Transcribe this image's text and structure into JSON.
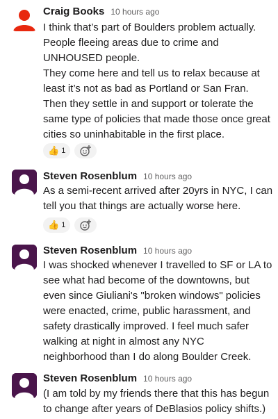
{
  "messages": [
    {
      "author": "Craig Books",
      "time": "10 hours ago",
      "avatar": "red-person-icon",
      "text": "I think that’s part of Boulders problem actually.\nPeople fleeing areas due to crime and\nUNHOUSED people.\nThey come here and tell us to relax because at\nleast it’s not as bad as Portland or San Fran.\nThen they settle in and support or tolerate the\nsame type of policies that made those once great\ncities so uninhabitable in the first place.",
      "reaction": {
        "emoji": "👍",
        "count": "1"
      }
    },
    {
      "author": "Steven Rosenblum",
      "time": "10 hours ago",
      "avatar": "purple-person-icon",
      "text": "As a semi-recent arrived after 20yrs in NYC, I can\ntell you that things are actually worse here.",
      "reaction": {
        "emoji": "👍",
        "count": "1"
      }
    },
    {
      "author": "Steven Rosenblum",
      "time": "10 hours ago",
      "avatar": "purple-person-icon",
      "text": "I was shocked whenever I travelled to SF or LA to\nsee what had become of the downtowns, but\neven since Giuliani's \"broken windows\" policies\nwere enacted, crime, public harassment, and\nsafety drastically improved.   I feel much safer\nwalking at night in almost any NYC\nneighborhood than I do along Boulder Creek."
    },
    {
      "author": "Steven Rosenblum",
      "time": "10 hours ago",
      "avatar": "purple-person-icon",
      "text": "(I am told by my friends there that this has begun\nto change after years of DeBlasios policy shifts.)"
    }
  ],
  "colors": {
    "red_avatar": "#e8280f",
    "purple_avatar": "#4a154b"
  }
}
